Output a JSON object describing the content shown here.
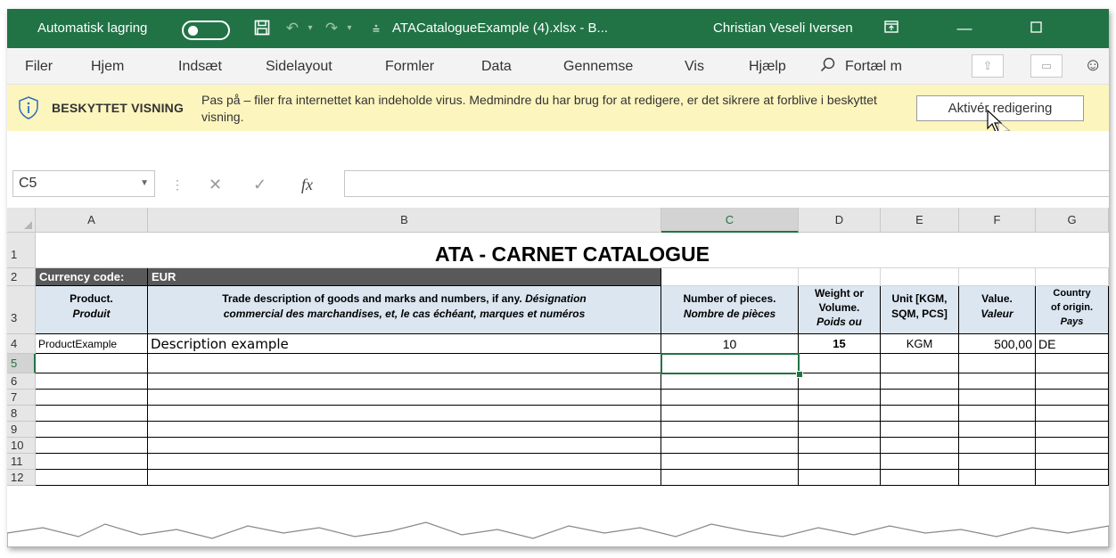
{
  "titlebar": {
    "autosave_label": "Automatisk lagring",
    "file_title": "ATACatalogueExample (4).xlsx  -  B...",
    "user": "Christian Veseli Iversen"
  },
  "menu": {
    "items": [
      "Filer",
      "Hjem",
      "Indsæt",
      "Sidelayout",
      "Formler",
      "Data",
      "Gennemse",
      "Vis",
      "Hjælp"
    ],
    "tell_me": "Fortæl m"
  },
  "protected_view": {
    "title": "BESKYTTET VISNING",
    "message": "Pas på – filer fra internettet kan indeholde virus. Medmindre du har brug for at redigere, er det sikrere at forblive i beskyttet visning.",
    "enable_button": "Aktivér redigering"
  },
  "formula_bar": {
    "name_box": "C5",
    "fx": "fx",
    "formula": ""
  },
  "sheet": {
    "columns": [
      "A",
      "B",
      "C",
      "D",
      "E",
      "F",
      "G"
    ],
    "selected_column": "C",
    "rows": [
      "1",
      "2",
      "3",
      "4",
      "5",
      "6",
      "7",
      "8",
      "9",
      "10",
      "11",
      "12"
    ],
    "selected_row": "5",
    "title": "ATA - CARNET CATALOGUE",
    "currency_label": "Currency code:",
    "currency_value": "EUR",
    "headers": {
      "a1": "Product.",
      "a2": "Produit",
      "b1": "Trade description of goods and marks and numbers, if any.",
      "b1i": "Désignation",
      "b2": "commercial des marchandises, et, le cas échéant, marques et numéros",
      "c1": "Number of pieces.",
      "c2": "Nombre de pièces",
      "d1": "Weight or",
      "d2": "Volume.",
      "d3": "Poids ou",
      "e1": "Unit [KGM,",
      "e2": "SQM, PCS]",
      "f1": "Value.",
      "f2": "Valeur",
      "g1": "Country",
      "g2": "of origin.",
      "g3": "Pays"
    },
    "data_row": {
      "product": "ProductExample",
      "description": "Description example",
      "pieces": "10",
      "weight": "15",
      "unit": "KGM",
      "value": "500,00",
      "country": "DE"
    }
  }
}
